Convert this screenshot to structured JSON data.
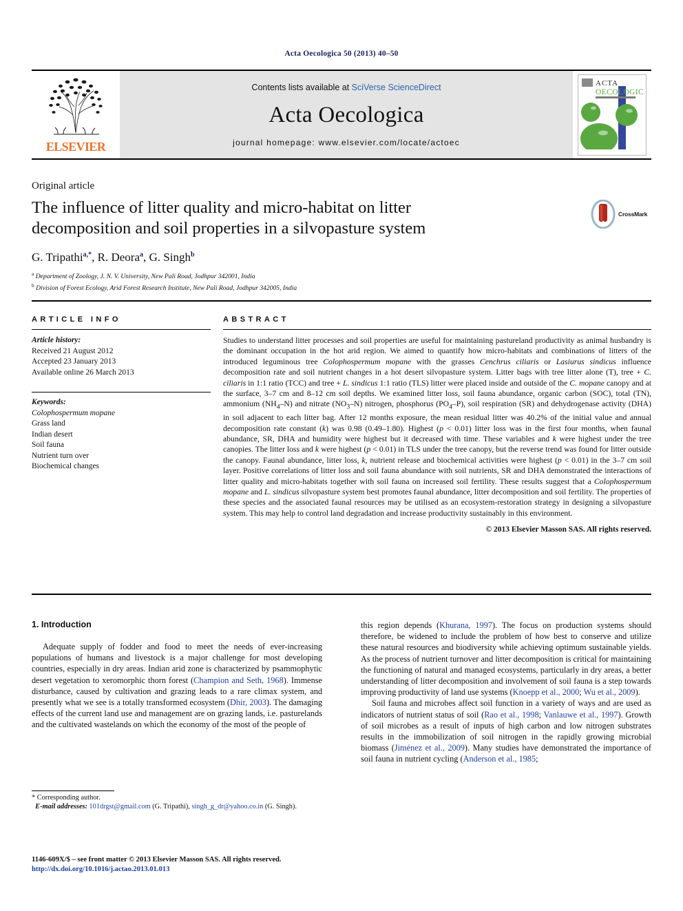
{
  "running_head": "Acta Oecologica 50 (2013) 40–50",
  "masthead": {
    "publisher_name": "ELSEVIER",
    "contents_prefix": "Contents lists available at ",
    "contents_link": "SciVerse ScienceDirect",
    "journal_name": "Acta Oecologica",
    "homepage": "journal homepage: www.elsevier.com/locate/actoec",
    "cover": {
      "line1": "ACTA",
      "line2": "OECOLOGICA",
      "accent_green": "#5aa842",
      "accent_blue": "#35479b"
    }
  },
  "article": {
    "type": "Original article",
    "title": "The influence of litter quality and micro-habitat on litter decomposition and soil properties in a silvopasture system",
    "authors": "G. Tripathi a,*, R. Deora a, G. Singh b",
    "affiliation_a": "Department of Zoology, J. N. V. University, New Pali Road, Jodhpur 342001, India",
    "affiliation_b": "Division of Forest Ecology, Arid Forest Research Institute, New Pali Road, Jodhpur 342005, India",
    "crossmark_label": "CrossMark"
  },
  "article_info": {
    "heading": "ARTICLE INFO",
    "history_label": "Article history:",
    "received": "Received 21 August 2012",
    "accepted": "Accepted 23 January 2013",
    "available": "Available online 26 March 2013",
    "keywords_label": "Keywords:",
    "keywords": [
      "Colophospermum mopane",
      "Grass land",
      "Indian desert",
      "Soil fauna",
      "Nutrient turn over",
      "Biochemical changes"
    ]
  },
  "abstract": {
    "heading": "ABSTRACT",
    "text": "Studies to understand litter processes and soil properties are useful for maintaining pastureland productivity as animal husbandry is the dominant occupation in the hot arid region. We aimed to quantify how micro-habitats and combinations of litters of the introduced leguminous tree Colophospermum mopane with the grasses Cenchrus ciliaris or Lasiurus sindicus influence decomposition rate and soil nutrient changes in a hot desert silvopasture system. Litter bags with tree litter alone (T), tree + C. ciliaris in 1:1 ratio (TCC) and tree + L. sindicus 1:1 ratio (TLS) litter were placed inside and outside of the C. mopane canopy and at the surface, 3–7 cm and 8–12 cm soil depths. We examined litter loss, soil fauna abundance, organic carbon (SOC), total (TN), ammonium (NH4–N) and nitrate (NO3–N) nitrogen, phosphorus (PO4–P), soil respiration (SR) and dehydrogenase activity (DHA) in soil adjacent to each litter bag. After 12 months exposure, the mean residual litter was 40.2% of the initial value and annual decomposition rate constant (k) was 0.98 (0.49–1.80). Highest (p < 0.01) litter loss was in the first four months, when faunal abundance, SR, DHA and humidity were highest but it decreased with time. These variables and k were highest under the tree canopies. The litter loss and k were highest (p < 0.01) in TLS under the tree canopy, but the reverse trend was found for litter outside the canopy. Faunal abundance, litter loss, k, nutrient release and biochemical activities were highest (p < 0.01) in the 3–7 cm soil layer. Positive correlations of litter loss and soil fauna abundance with soil nutrients, SR and DHA demonstrated the interactions of litter quality and micro-habitats together with soil fauna on increased soil fertility. These results suggest that a Colophospermum mopane and L. sindicus silvopasture system best promotes faunal abundance, litter decomposition and soil fertility. The properties of these species and the associated faunal resources may be utilised as an ecosystem-restoration strategy in designing a silvopasture system. This may help to control land degradation and increase productivity sustainably in this environment.",
    "copyright": "© 2013 Elsevier Masson SAS. All rights reserved."
  },
  "introduction": {
    "heading": "1. Introduction",
    "left_para_1": "Adequate supply of fodder and food to meet the needs of ever-increasing populations of humans and livestock is a major challenge for most developing countries, especially in dry areas. Indian arid zone is characterized by psammophytic desert vegetation to xeromorphic thorn forest (Champion and Seth, 1968). Immense disturbance, caused by cultivation and grazing leads to a rare climax system, and presently what we see is a totally transformed ecosystem (Dhir, 2003). The damaging effects of the current land use and management are on grazing lands, i.e. pasturelands and the cultivated wastelands on which the economy of the most of the people of",
    "right_para_1_cont": "this region depends (Khurana, 1997). The focus on production systems should therefore, be widened to include the problem of how best to conserve and utilize these natural resources and biodiversity while achieving optimum sustainable yields. As the process of nutrient turnover and litter decomposition is critical for maintaining the functioning of natural and managed ecosystems, particularly in dry areas, a better understanding of litter decomposition and involvement of soil fauna is a step towards improving productivity of land use systems (Knoepp et al., 2000; Wu et al., 2009).",
    "right_para_2": "Soil fauna and microbes affect soil function in a variety of ways and are used as indicators of nutrient status of soil (Rao et al., 1998; Vanlauwe et al., 1997). Growth of soil microbes as a result of inputs of high carbon and low nitrogen substrates results in the immobilization of soil nitrogen in the rapidly growing microbial biomass (Jiménez et al., 2009). Many studies have demonstrated the importance of soil fauna in nutrient cycling (Anderson et al., 1985;",
    "refs": [
      "Champion and Seth, 1968",
      "Dhir, 2003",
      "Khurana, 1997",
      "Knoepp et al., 2000",
      "Wu et al., 2009",
      "Rao et al., 1998",
      "Vanlauwe et al., 1997",
      "Jiménez et al., 2009",
      "Anderson et al., 1985"
    ]
  },
  "footnotes": {
    "corresponding": "* Corresponding author.",
    "email_label": "E-mail addresses:",
    "email_1": "101drgst@gmail.com",
    "email_1_owner": "(G. Tripathi)",
    "email_2": "singh_g_dr@yahoo.co.in",
    "email_2_owner": "(G. Singh)."
  },
  "imprint": {
    "line1": "1146-609X/$ – see front matter © 2013 Elsevier Masson SAS. All rights reserved.",
    "doi": "http://dx.doi.org/10.1016/j.actao.2013.01.013"
  }
}
